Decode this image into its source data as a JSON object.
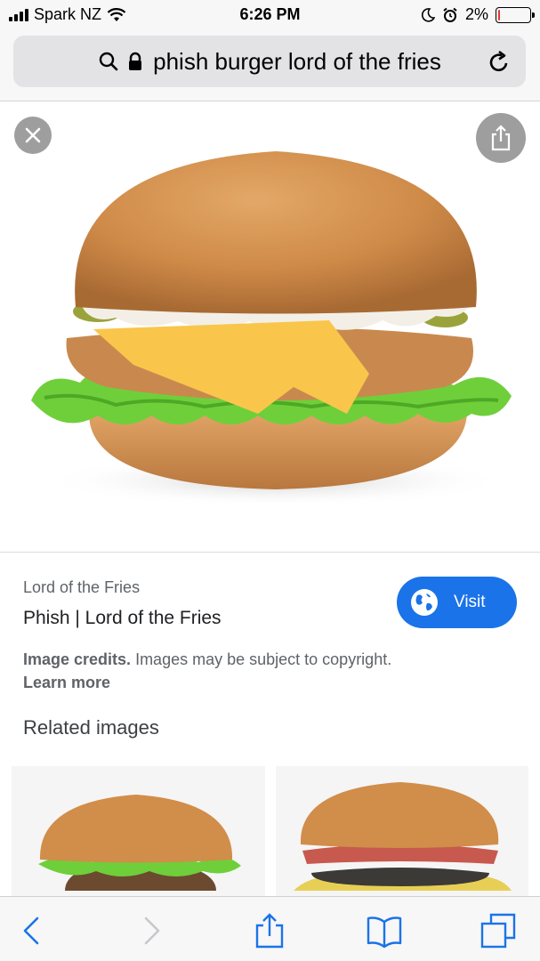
{
  "status": {
    "carrier": "Spark NZ",
    "time": "6:26 PM",
    "battery_pct": "2%",
    "battery_level": 0.02,
    "battery_color": "#e53935"
  },
  "address_bar": {
    "url_text": "phish burger lord of the fries",
    "icons": [
      "search-icon",
      "lock-icon",
      "reload-icon"
    ]
  },
  "viewer": {
    "close_icon": "close-icon",
    "share_icon": "share-icon"
  },
  "result": {
    "site_name": "Lord of the Fries",
    "title": "Phish | Lord of the Fries",
    "visit_label": "Visit",
    "credits_bold": "Image credits.",
    "credits_text": " Images may be subject to copyright.",
    "learn_more": "Learn more",
    "accent": "#1a73e8"
  },
  "related": {
    "title": "Related images"
  },
  "toolbar": {
    "icons": [
      "back-icon",
      "forward-icon",
      "share-icon",
      "bookmarks-icon",
      "tabs-icon"
    ],
    "active_color": "#1a73e8",
    "disabled_color": "#c7c7cc"
  }
}
